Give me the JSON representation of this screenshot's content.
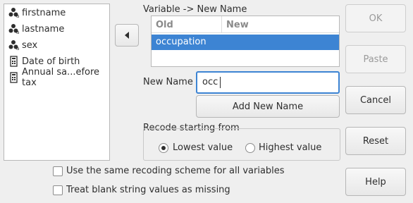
{
  "variables": [
    {
      "label": "firstname",
      "icon": "nominal-icon"
    },
    {
      "label": "lastname",
      "icon": "nominal-icon"
    },
    {
      "label": "sex",
      "icon": "nominal-icon"
    },
    {
      "label": "Date of birth",
      "icon": "scale-icon"
    },
    {
      "label": "Annual sa...efore tax",
      "icon": "scale-icon"
    }
  ],
  "mapping": {
    "title": "Variable -> New Name",
    "col_old": "Old",
    "col_new": "New",
    "rows": [
      {
        "old": "occupation",
        "new": ""
      }
    ]
  },
  "new_name": {
    "label": "New Name",
    "value": "occ",
    "add_button": "Add New Name"
  },
  "recode": {
    "title": "Recode starting from",
    "options": [
      {
        "label": "Lowest value",
        "selected": true
      },
      {
        "label": "Highest value",
        "selected": false
      }
    ]
  },
  "options": {
    "same_scheme": "Use the same recoding scheme for all variables",
    "blank_missing": "Treat blank string values as missing"
  },
  "buttons": {
    "ok": "OK",
    "paste": "Paste",
    "cancel": "Cancel",
    "reset": "Reset",
    "help": "Help"
  },
  "colors": {
    "selection": "#3d84d3",
    "focus": "#3d84d3"
  }
}
